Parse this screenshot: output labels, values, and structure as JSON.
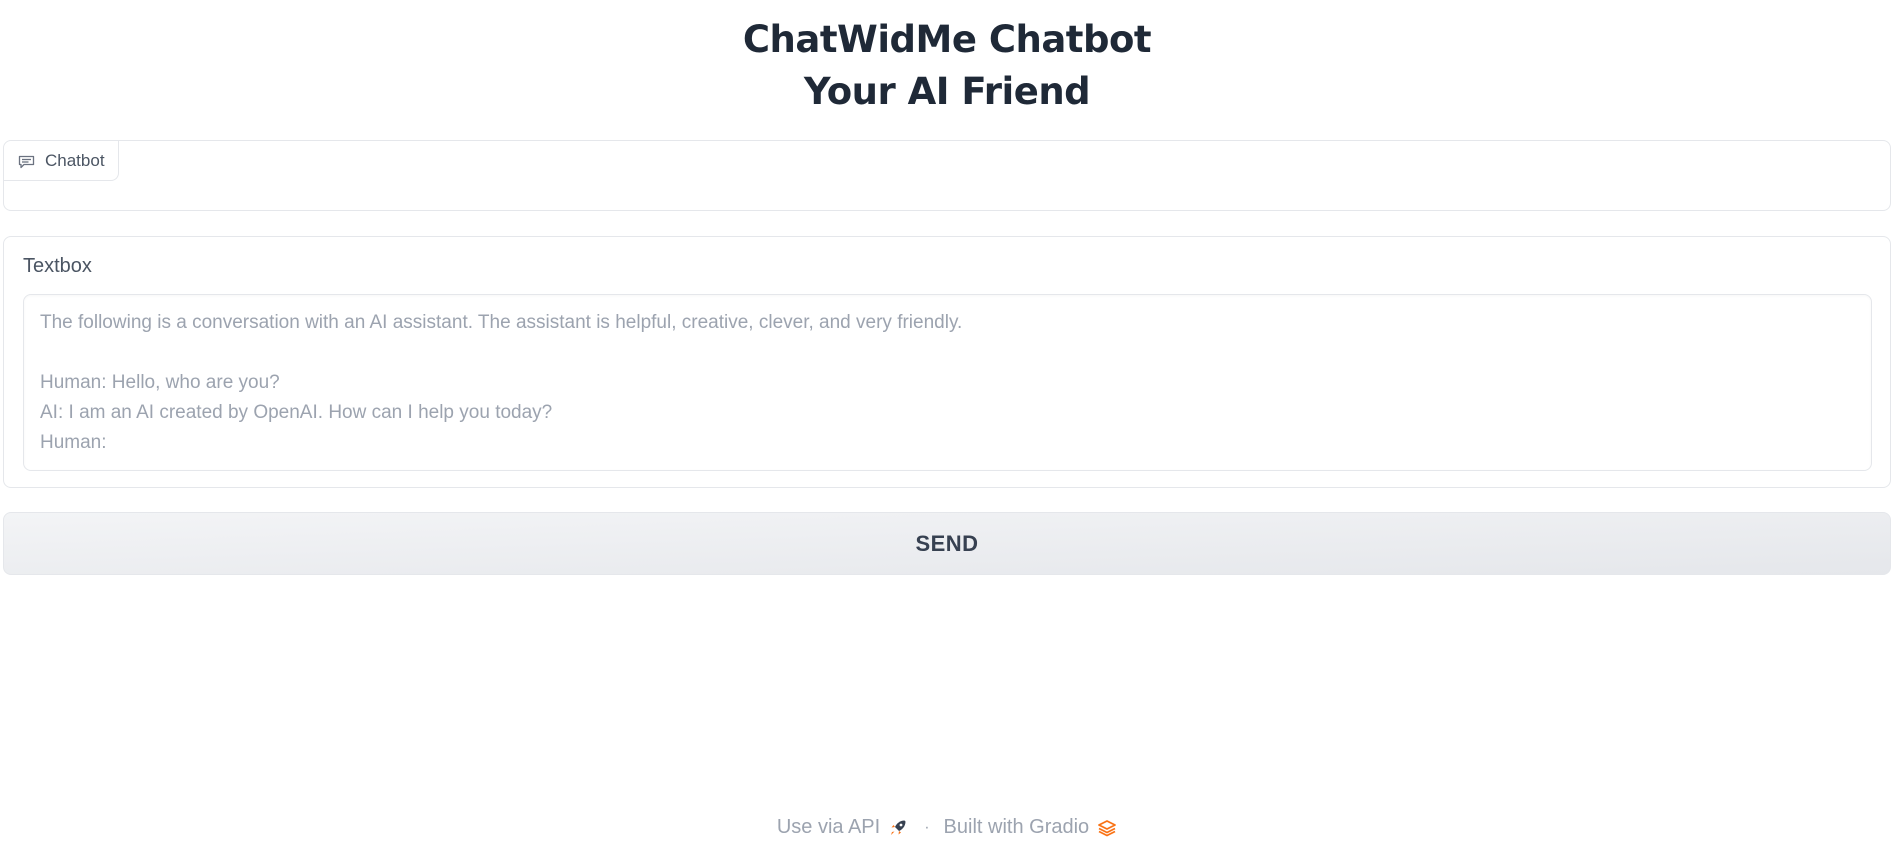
{
  "header": {
    "title_line1": "ChatWidMe Chatbot",
    "title_line2": "Your AI Friend"
  },
  "chatbot": {
    "label": "Chatbot",
    "icon": "chat-bubble-icon"
  },
  "textbox": {
    "label": "Textbox",
    "value": "",
    "placeholder": "The following is a conversation with an AI assistant. The assistant is helpful, creative, clever, and very friendly.\n\nHuman: Hello, who are you?\nAI: I am an AI created by OpenAI. How can I help you today?\nHuman: "
  },
  "send_button": {
    "label": "SEND"
  },
  "footer": {
    "api_link": "Use via API",
    "api_icon": "rocket-icon",
    "separator": "·",
    "built_with": "Built with Gradio",
    "gradio_icon": "gradio-logo-icon"
  },
  "colors": {
    "text_primary": "#1f2937",
    "label_gray": "#4b5563",
    "placeholder_gray": "#9ca3af",
    "border": "#e5e7eb",
    "accent_orange": "#f97316"
  }
}
